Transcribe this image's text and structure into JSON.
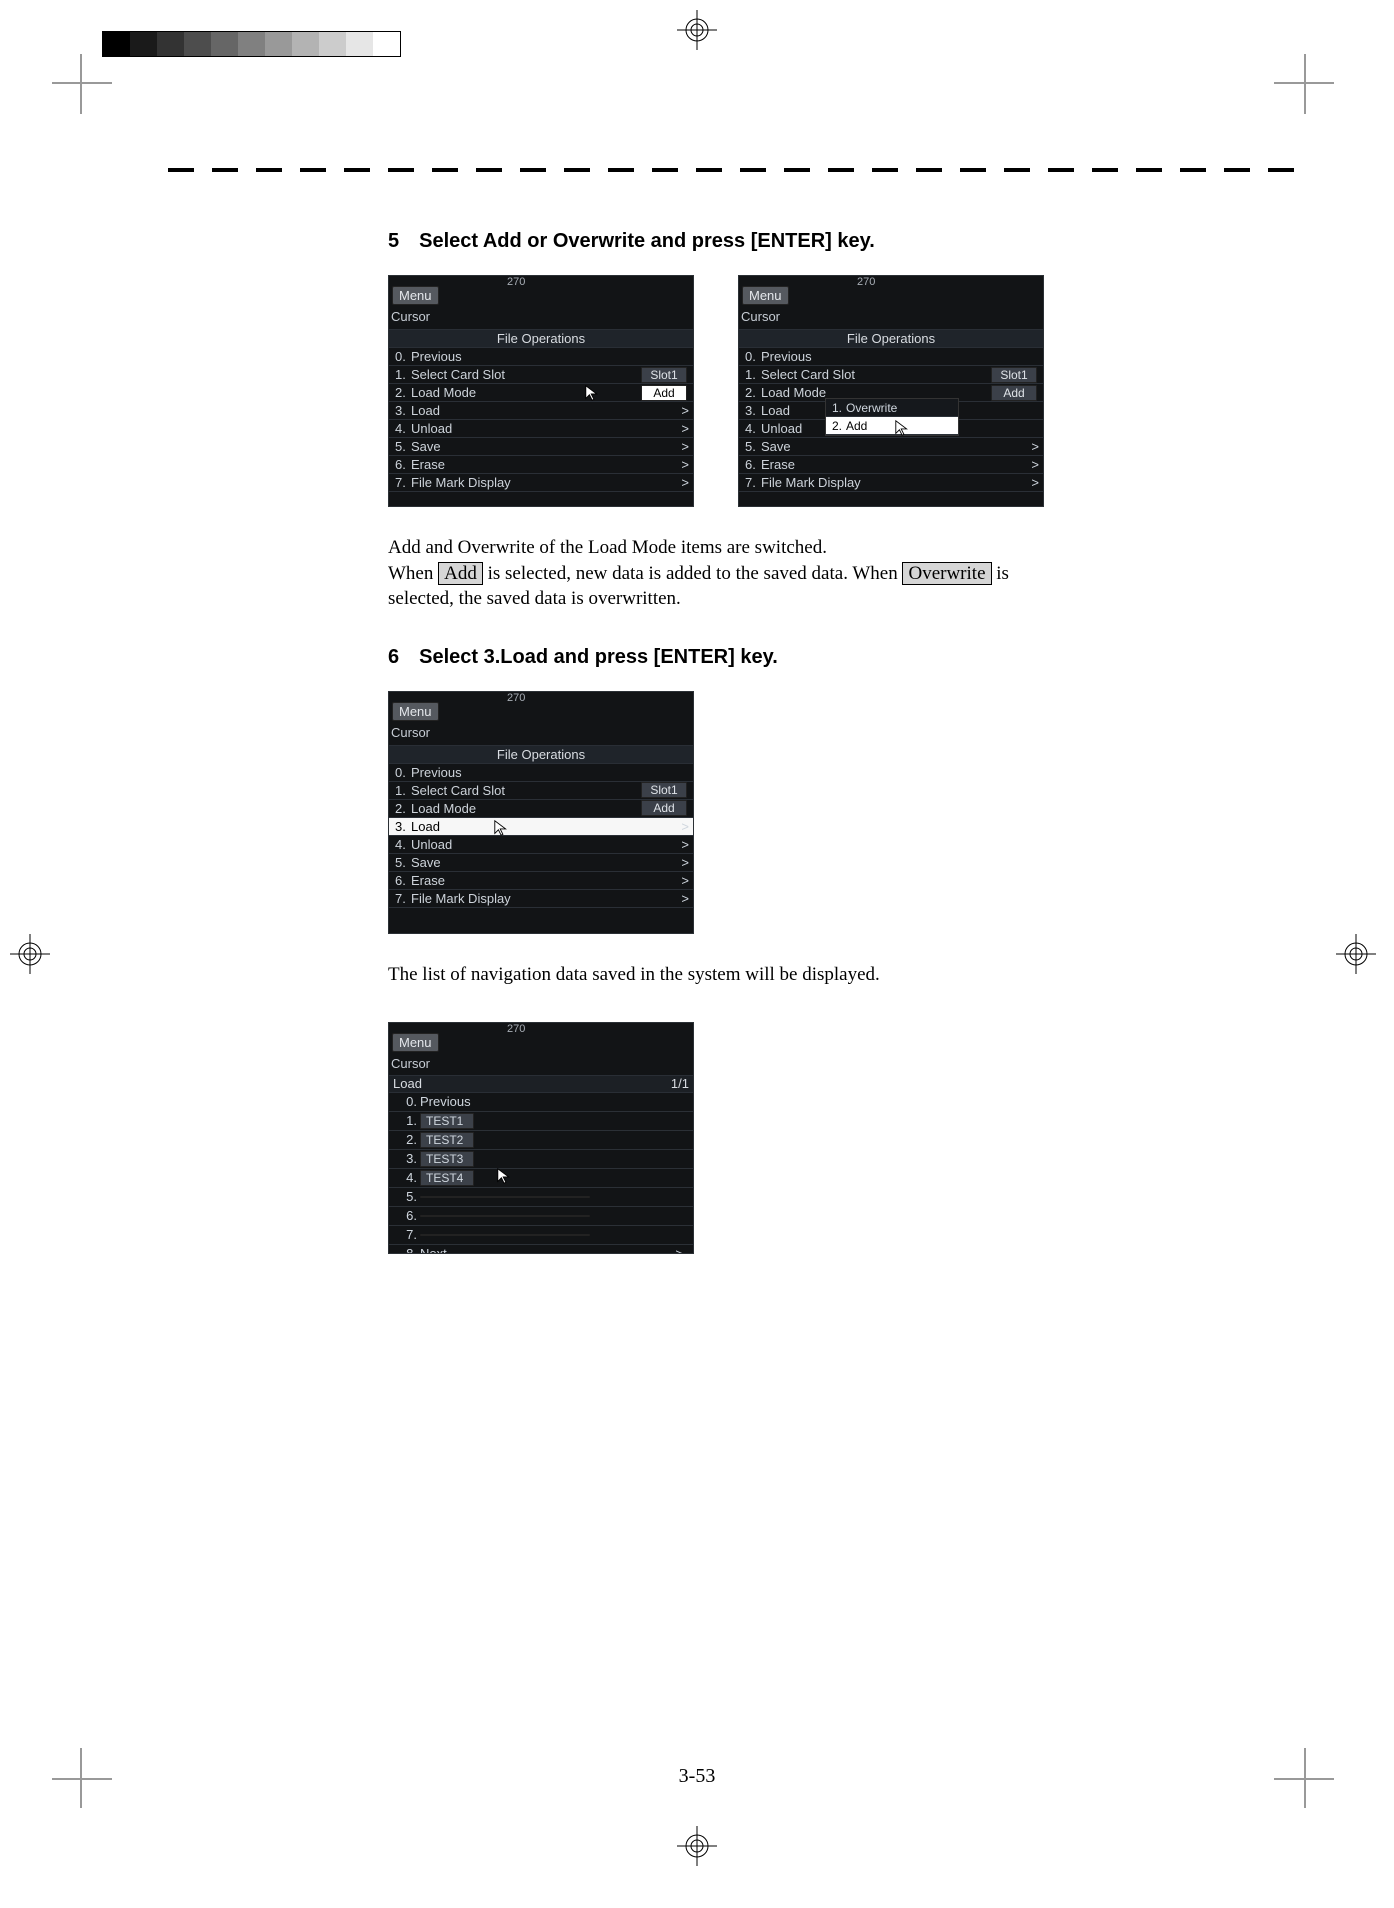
{
  "page_number": "3-53",
  "step5": {
    "number": "5",
    "heading": "Select Add or Overwrite and press [ENTER] key."
  },
  "step6": {
    "number": "6",
    "heading": "Select    3.Load and press [ENTER] key."
  },
  "explanation5": {
    "line1": "Add and Overwrite of the Load Mode items are switched.",
    "line2a": "When ",
    "btn_add": " Add ",
    "line2b": " is selected, new data is added to the saved data.    When ",
    "btn_overwrite": " Overwrite ",
    "line2c": " is",
    "line3": "selected, the saved data is overwritten."
  },
  "explanation6": "The list of navigation data saved in the system will be displayed.",
  "scr_common": {
    "menu": "Menu",
    "cursor": "Cursor",
    "title": "File Operations",
    "heading_num": "270",
    "row0": "Previous",
    "row1": "Select Card Slot",
    "row1_val": "Slot1",
    "row2": "Load Mode",
    "row2_val": "Add",
    "row3": "Load",
    "row4": "Unload",
    "row5": "Save",
    "row6": "Erase",
    "row7": "File Mark Display",
    "popup_1": "Overwrite",
    "popup_2": "Add",
    "gt": ">"
  },
  "load_scr": {
    "title": "Load",
    "page": "1/1",
    "items": [
      "Previous",
      "TEST1",
      "TEST2",
      "TEST3",
      "TEST4",
      "",
      "",
      "",
      "Next"
    ]
  }
}
